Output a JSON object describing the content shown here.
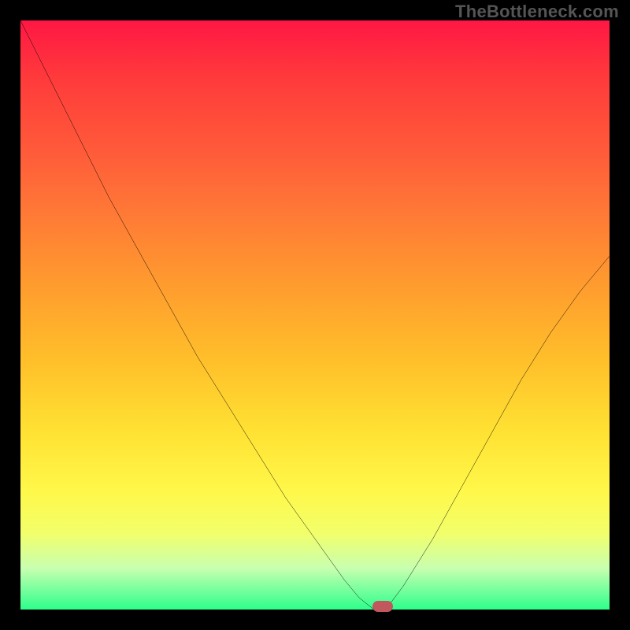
{
  "watermark": "TheBottleneck.com",
  "colors": {
    "gradient_top": "#ff1744",
    "gradient_mid": "#ffe233",
    "gradient_bottom": "#2dff8c",
    "curve": "#000000",
    "marker": "#c1585e",
    "background": "#000000"
  },
  "chart_data": {
    "type": "line",
    "title": "",
    "xlabel": "",
    "ylabel": "",
    "xlim": [
      0,
      100
    ],
    "ylim": [
      0,
      100
    ],
    "grid": false,
    "series": [
      {
        "name": "bottleneck-curve",
        "x": [
          0,
          5,
          10,
          15,
          20,
          25,
          30,
          35,
          40,
          45,
          50,
          55,
          57.5,
          60,
          62,
          65,
          70,
          75,
          80,
          85,
          90,
          95,
          100
        ],
        "y": [
          100,
          90,
          80,
          70,
          61,
          52,
          43,
          35,
          27,
          19,
          12,
          5,
          2,
          0,
          0,
          4,
          12,
          21,
          30,
          39,
          47,
          54,
          60
        ]
      }
    ],
    "annotations": [
      {
        "name": "optimal-marker",
        "x": 61.5,
        "y": 0.5
      }
    ]
  }
}
